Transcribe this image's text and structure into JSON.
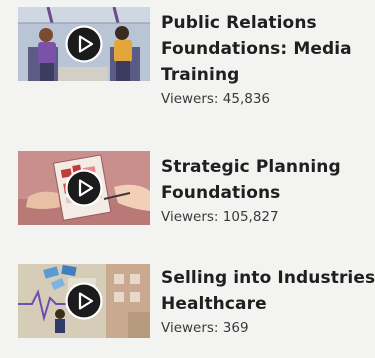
{
  "courses": [
    {
      "title_lines": [
        "Public Relations",
        "Foundations: Media",
        "Training"
      ],
      "viewers_label": "Viewers:",
      "viewers_count": "45,836",
      "thumbnail_icon": "play-icon"
    },
    {
      "title_lines": [
        "Strategic Planning",
        "Foundations"
      ],
      "viewers_label": "Viewers:",
      "viewers_count": "105,827",
      "thumbnail_icon": "play-icon"
    },
    {
      "title_lines": [
        "Selling into Industries:",
        "Healthcare"
      ],
      "viewers_label": "Viewers:",
      "viewers_count": "369",
      "thumbnail_icon": "play-icon"
    }
  ],
  "colors": {
    "background": "#f3f3f2",
    "title_text": "#1f1f1f",
    "meta_text": "#3a3a3a",
    "play_button_fill": "#1b1b1b"
  }
}
